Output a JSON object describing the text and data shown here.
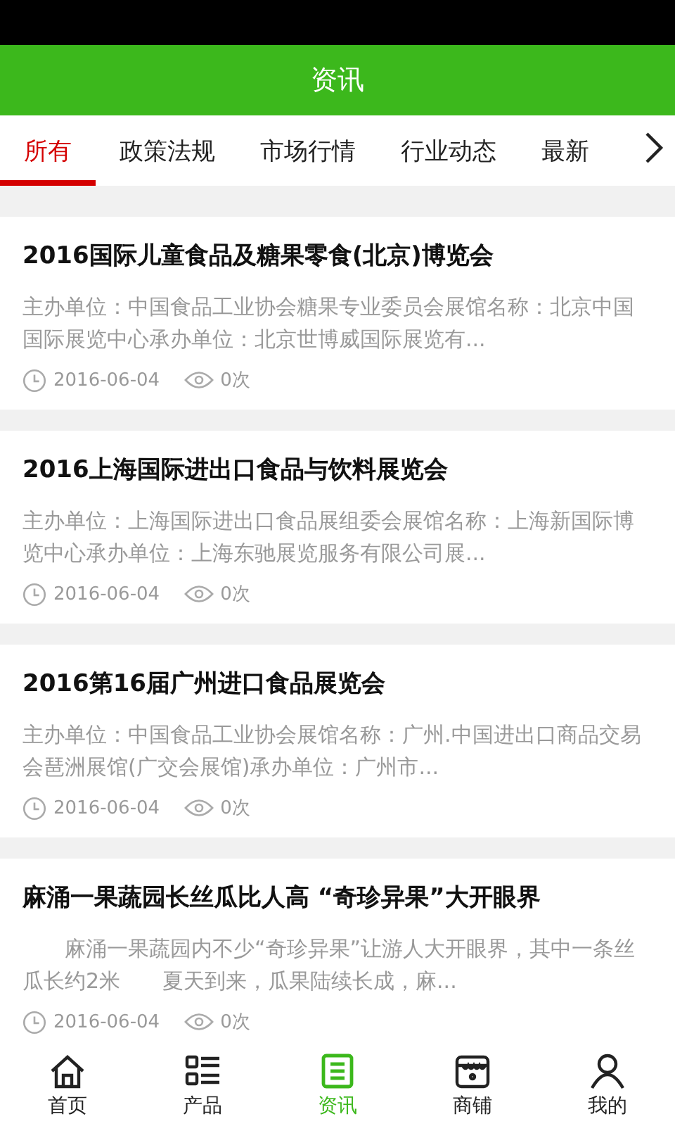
{
  "header": {
    "title": "资讯"
  },
  "tabs": [
    {
      "label": "所有",
      "selected": true
    },
    {
      "label": "政策法规",
      "selected": false
    },
    {
      "label": "市场行情",
      "selected": false
    },
    {
      "label": "行业动态",
      "selected": false
    },
    {
      "label": "最新",
      "selected": false
    }
  ],
  "articles": [
    {
      "title": "2016国际儿童食品及糖果零食(北京)博览会",
      "summary": "主办单位：中国食品工业协会糖果专业委员会展馆名称：北京中国国际展览中心承办单位：北京世博威国际展览有...",
      "date": "2016-06-04",
      "views": "0次"
    },
    {
      "title": "2016上海国际进出口食品与饮料展览会",
      "summary": "主办单位：上海国际进出口食品展组委会展馆名称：上海新国际博览中心承办单位：上海东驰展览服务有限公司展...",
      "date": "2016-06-04",
      "views": "0次"
    },
    {
      "title": "2016第16届广州进口食品展览会",
      "summary": "主办单位：中国食品工业协会展馆名称：广州.中国进出口商品交易会琶洲展馆(广交会展馆)承办单位：广州市...",
      "date": "2016-06-04",
      "views": "0次"
    },
    {
      "title": "麻涌一果蔬园长丝瓜比人高 “奇珍异果”大开眼界",
      "summary": "　　麻涌一果蔬园内不少“奇珍异果”让游人大开眼界，其中一条丝瓜长约2米　　夏天到来，瓜果陆续长成，麻...",
      "date": "2016-06-04",
      "views": "0次"
    }
  ],
  "nav": [
    {
      "label": "首页",
      "kind": "home",
      "selected": false
    },
    {
      "label": "产品",
      "kind": "list",
      "selected": false
    },
    {
      "label": "资讯",
      "kind": "news",
      "selected": true
    },
    {
      "label": "商铺",
      "kind": "shop",
      "selected": false
    },
    {
      "label": "我的",
      "kind": "person",
      "selected": false
    }
  ]
}
